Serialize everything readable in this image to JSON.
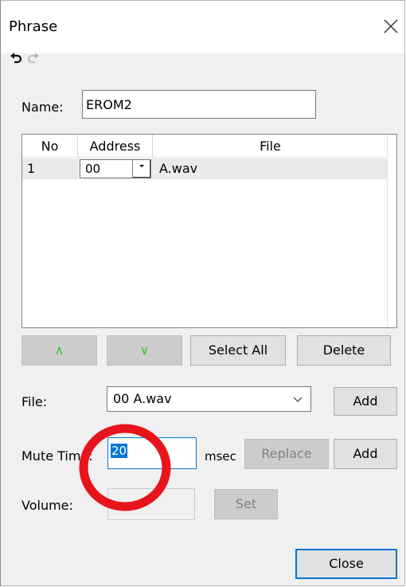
{
  "window": {
    "title": "Phrase"
  },
  "name_field": {
    "label": "Name:",
    "value": "EROM2"
  },
  "list": {
    "columns": [
      "No",
      "Address",
      "File"
    ],
    "rows": [
      {
        "no": "1",
        "address": "00",
        "file": "A.wav"
      }
    ]
  },
  "list_buttons": {
    "up": "∧",
    "down": "∨",
    "select_all": "Select All",
    "delete": "Delete"
  },
  "file_row": {
    "label": "File:",
    "selected": "00 A.wav",
    "add": "Add"
  },
  "mute_row": {
    "label": "Mute Time:",
    "value": "20",
    "unit": "msec",
    "replace": "Replace",
    "add": "Add"
  },
  "volume_row": {
    "label": "Volume:",
    "value": "",
    "set": "Set"
  },
  "close_button": "Close",
  "colors": {
    "selection": "#0078d7",
    "arrow_green": "#2ec82e",
    "annotation_red": "#e8141b"
  }
}
